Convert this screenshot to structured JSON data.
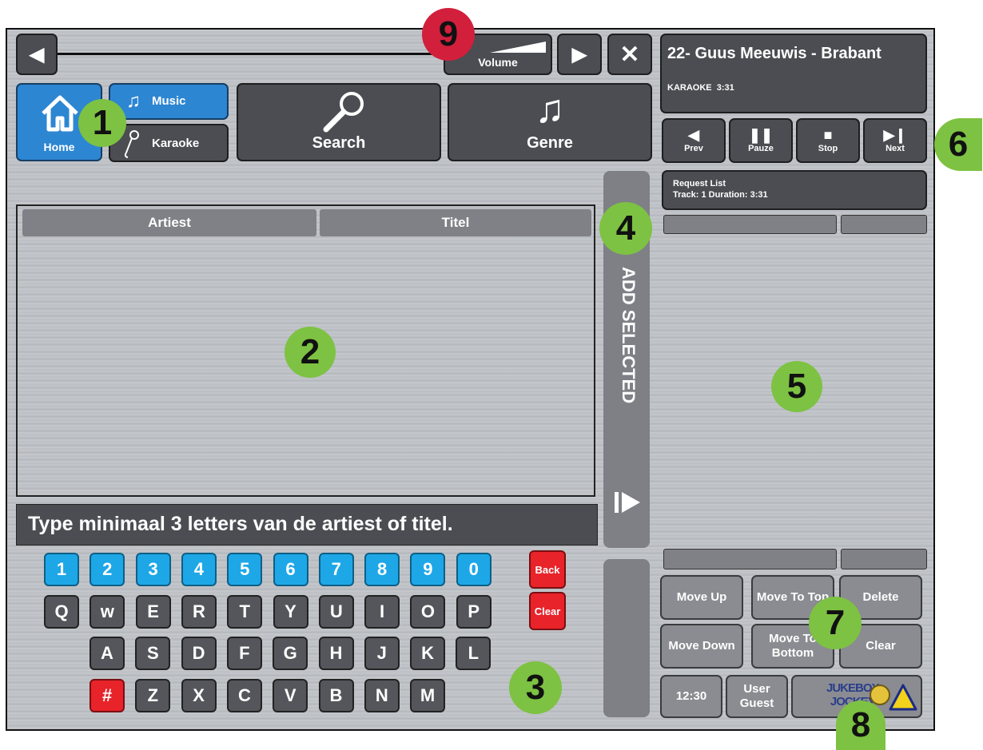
{
  "topbar": {
    "volume_label": "Volume",
    "prev_glyph": "◀",
    "next_glyph": "▶",
    "close_glyph": "✕"
  },
  "now_playing": {
    "title": "22- Guus Meeuwis - Brabant",
    "subtitle": "KARAOKE  3:31"
  },
  "transport": [
    {
      "label": "Prev",
      "icon": "prev-icon",
      "glyph": "◀"
    },
    {
      "label": "Pauze",
      "icon": "pause-icon",
      "glyph": "❚❚"
    },
    {
      "label": "Stop",
      "icon": "stop-icon",
      "glyph": "■"
    },
    {
      "label": "Next",
      "icon": "next-icon",
      "glyph": "▶❙"
    }
  ],
  "nav": {
    "home": "Home",
    "music": "Music",
    "karaoke": "Karaoke",
    "search": "Search",
    "genre": "Genre"
  },
  "results_table": {
    "columns": [
      "Artiest",
      "Titel"
    ],
    "rows": []
  },
  "add_selected": "ADD SELECTED",
  "hint": "Type minimaal 3 letters van de artiest of titel.",
  "keyboard": {
    "row1": [
      "1",
      "2",
      "3",
      "4",
      "5",
      "6",
      "7",
      "8",
      "9",
      "0"
    ],
    "row2": [
      "Q",
      "w",
      "E",
      "R",
      "T",
      "Y",
      "U",
      "I",
      "O",
      "P"
    ],
    "row3": [
      "A",
      "S",
      "D",
      "F",
      "G",
      "H",
      "J",
      "K",
      "L"
    ],
    "row4": [
      "#",
      "Z",
      "X",
      "C",
      "V",
      "B",
      "N",
      "M"
    ],
    "back": "Back",
    "clear": "Clear"
  },
  "request_list": {
    "title": "Request List",
    "info": "Track: 1 Duration: 3:31",
    "rows": []
  },
  "queue_controls": {
    "move_up": "Move Up",
    "move_to_top": "Move To Top",
    "delete": "Delete",
    "move_down": "Move Down",
    "move_to_bottom": "Move To Bottom",
    "clear": "Clear"
  },
  "status": {
    "time": "12:30",
    "user_label": "User",
    "user_name": "Guest",
    "logo_line1": "JUKEBOX",
    "logo_line2": "JOCKEY"
  },
  "callouts": [
    "1",
    "2",
    "3",
    "4",
    "5",
    "6",
    "7",
    "8",
    "9"
  ],
  "colors": {
    "accent_blue": "#2d86d2",
    "key_blue": "#1ea7e6",
    "key_red": "#e8232a",
    "callout_green": "#7dc242",
    "callout_red": "#d21f3c"
  }
}
